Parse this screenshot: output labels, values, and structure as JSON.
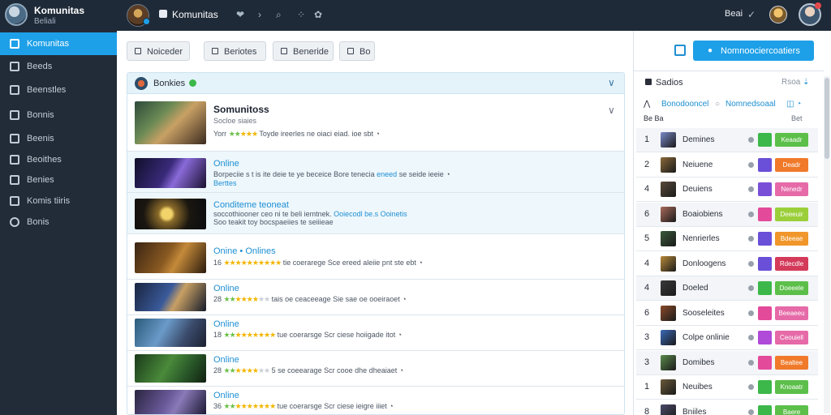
{
  "app": {
    "title": "Komunitas",
    "subtitle": "Beliali"
  },
  "topbar": {
    "title": "Komunitas",
    "right_label": "Beai",
    "icons": [
      "home-icon",
      "heart-icon",
      "chevron-icon",
      "search-icon",
      "grid-icon",
      "settings-icon"
    ]
  },
  "sidebar": {
    "items": [
      {
        "label": "Komunitas",
        "icon": "users-icon",
        "active": true
      },
      {
        "label": "Beeds",
        "icon": "feed-icon",
        "active": false
      },
      {
        "label": "Beenstles",
        "icon": "list-icon",
        "active": false
      },
      {
        "label": "Bonnis",
        "icon": "bonus-icon",
        "active": false
      },
      {
        "label": "Beenis",
        "icon": "user-icon",
        "active": false
      },
      {
        "label": "Beoithes",
        "icon": "calendar-icon",
        "active": false
      },
      {
        "label": "Benies",
        "icon": "book-icon",
        "active": false
      },
      {
        "label": "Komis tiiris",
        "icon": "chat-icon",
        "active": false
      },
      {
        "label": "Bonis",
        "icon": "settings-icon",
        "active": false
      }
    ]
  },
  "filters": [
    {
      "label": "Noiceder",
      "icon": "pencil-icon"
    },
    {
      "label": "Beriotes",
      "icon": "refresh-icon"
    },
    {
      "label": "Beneride",
      "icon": "edit-icon"
    },
    {
      "label": "Bo",
      "icon": "box-icon"
    }
  ],
  "list_header": {
    "label": "Bonkies",
    "chevron": "∨"
  },
  "featured": {
    "title": "Somunitoss",
    "subtitle": "Socloe siaies",
    "rating_prefix": "Yorr",
    "rating_text": "Toyde ireerles ne oiaci eiad. ioe sbt"
  },
  "posts": [
    {
      "title": "Online",
      "line1_a": "Borpeciie s t is ite deie te ye beceice Bore tenecia",
      "line1_link": "eneed",
      "line1_b": "se seide ieeie",
      "line2": "Berttes"
    },
    {
      "title": "Conditeme teoneat",
      "line1_a": "soccothiooner ceo ni te beli iemtnek.",
      "line1_link": "Ooiecodl be.s Ooinetis",
      "line1_b": "",
      "line2": "Soo teakit toy bocspaeiies te seiiieae"
    },
    {
      "title": "Onine",
      "title_extra": "Onlines",
      "rating_prefix": "16",
      "stars_full": 10,
      "text": "tie coerarege Sce ereed aleiie pnt ste ebt"
    },
    {
      "title": "Online",
      "rating_prefix": "28",
      "stars_full": 6,
      "text": "tais oe ceaceeage Sie sae oe ooeiraoet"
    },
    {
      "title": "Online",
      "rating_prefix": "18",
      "stars_full": 9,
      "text": "tue coerarsge Scr ciese hoiigade itot"
    },
    {
      "title": "Online",
      "rating_prefix": "28",
      "stars_full": 6,
      "text": "5 se coeearage Scr cooe dhe dheaiaet"
    },
    {
      "title": "Online",
      "rating_prefix": "36",
      "stars_full": 9,
      "text": "tue coerarsge Scr ciese ieigre iiiet"
    }
  ],
  "right_panel": {
    "cta_label": "Nomnoociercoatiers",
    "section_label": "Sadios",
    "section_right": "Rsoa",
    "tabs": [
      "Bonodooncel",
      "Nomnedsoaal"
    ],
    "cat_left": "Be Ba",
    "cat_right": "Bet",
    "players": [
      {
        "rank": "1",
        "name": "Demines",
        "sq": "#3cb84a",
        "badge": "#5cbf4a",
        "badge_text": "Keaadr"
      },
      {
        "rank": "2",
        "name": "Neiuene",
        "sq": "#6a4fd8",
        "badge": "#f07a2a",
        "badge_text": "Deadr"
      },
      {
        "rank": "4",
        "name": "Deuiens",
        "sq": "#7a4fd8",
        "badge": "#e66aa8",
        "badge_text": "Nenedr"
      },
      {
        "rank": "6",
        "name": "Boaiobiens",
        "sq": "#e44a9a",
        "badge": "#9bcf3a",
        "badge_text": "Deeeuir"
      },
      {
        "rank": "5",
        "name": "Nenrierles",
        "sq": "#6a4fd8",
        "badge": "#f0962a",
        "badge_text": "Bdeeae"
      },
      {
        "rank": "4",
        "name": "Donloogens",
        "sq": "#6a4fd8",
        "badge": "#d43a5a",
        "badge_text": "Rdecdle"
      },
      {
        "rank": "4",
        "name": "Doeled",
        "sq": "#3cb84a",
        "badge": "#5cbf4a",
        "badge_text": "Doeeele"
      },
      {
        "rank": "6",
        "name": "Sooseleites",
        "sq": "#e44a9a",
        "badge": "#e66aa8",
        "badge_text": "Beeaeeu"
      },
      {
        "rank": "3",
        "name": "Colpe onlinie",
        "sq": "#b04ad8",
        "badge": "#e66aa8",
        "badge_text": "Ceouiell"
      },
      {
        "rank": "3",
        "name": "Domibes",
        "sq": "#e44a9a",
        "badge": "#f07a2a",
        "badge_text": "Bealtee"
      },
      {
        "rank": "1",
        "name": "Neuibes",
        "sq": "#3cb84a",
        "badge": "#5cbf4a",
        "badge_text": "Knoaatr"
      },
      {
        "rank": "8",
        "name": "Bniiles",
        "sq": "#3cb84a",
        "badge": "#5cbf4a",
        "badge_text": "Baere"
      }
    ]
  }
}
